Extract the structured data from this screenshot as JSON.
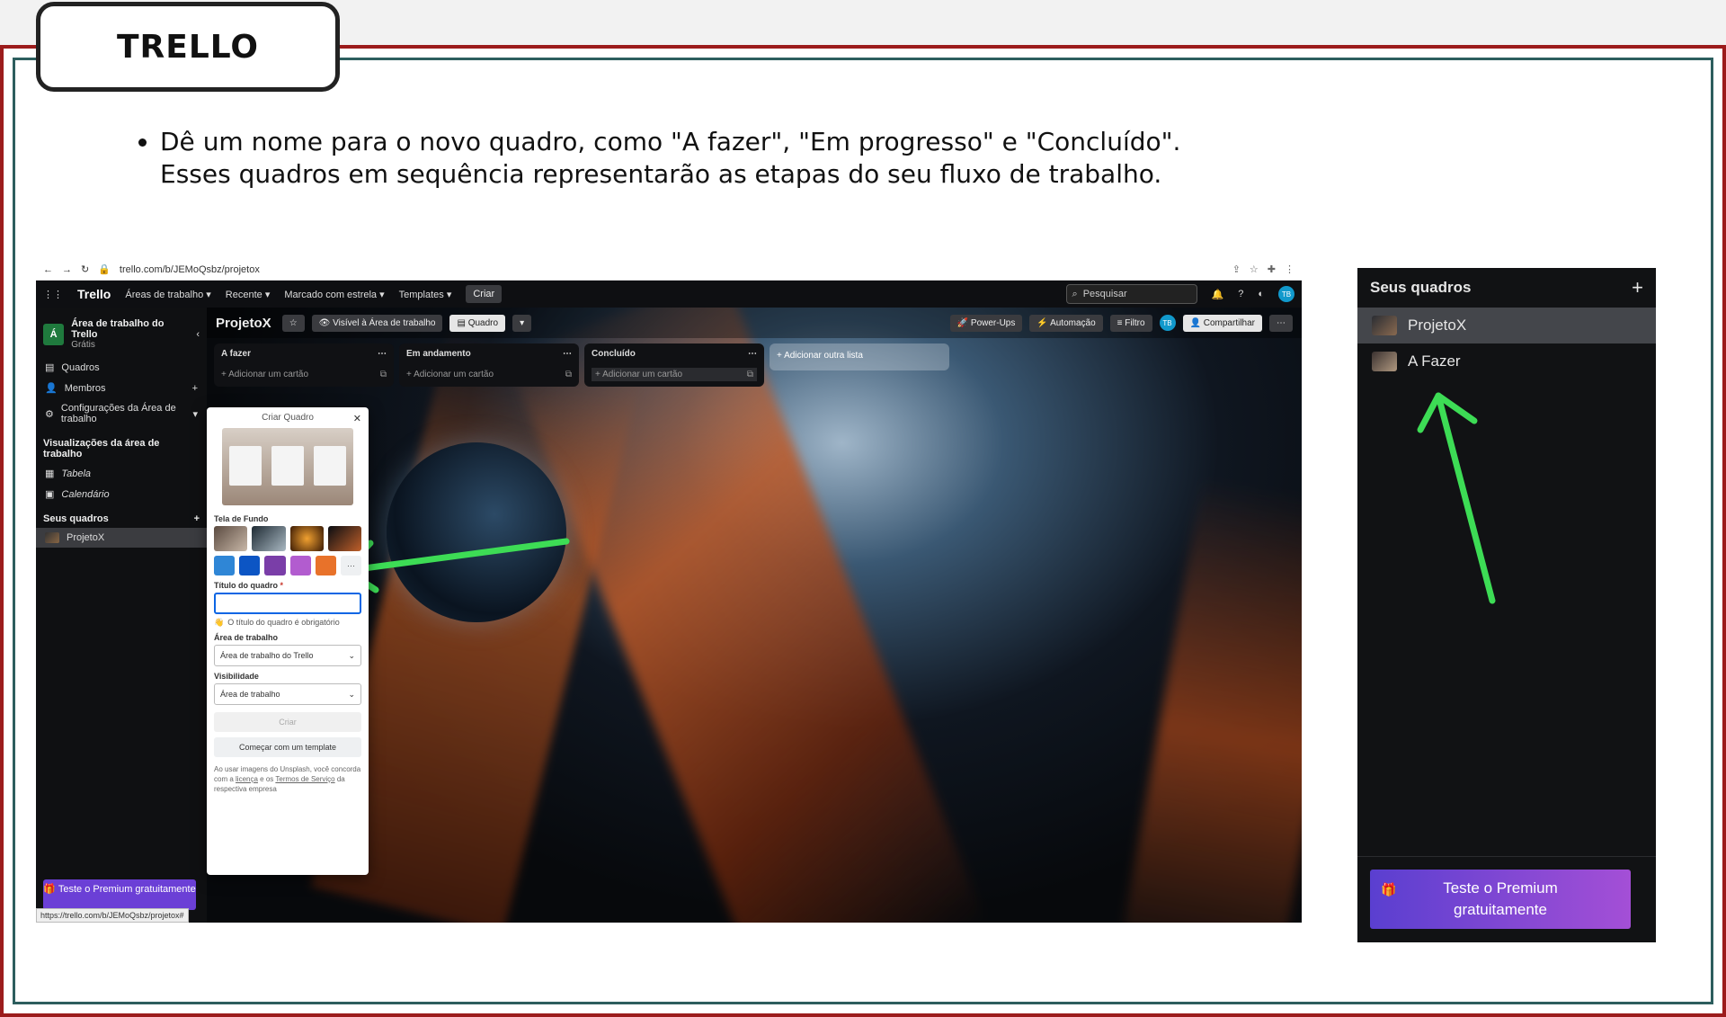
{
  "slide": {
    "title": "TRELLO",
    "bullet_line1": "Dê um nome para o novo quadro, como \"A fazer\", \"Em progresso\" e \"Concluído\".",
    "bullet_line2": "Esses quadros em sequência representarão as etapas do seu fluxo de trabalho."
  },
  "browser": {
    "url": "trello.com/b/JEMoQsbz/projetox",
    "status_url": "https://trello.com/b/JEMoQsbz/projetox#"
  },
  "topnav": {
    "logo": "Trello",
    "workspaces": "Áreas de trabalho",
    "recent": "Recente",
    "starred": "Marcado com estrela",
    "templates": "Templates",
    "create": "Criar",
    "search_placeholder": "Pesquisar",
    "avatar_initials": "TB"
  },
  "sidebar": {
    "badge": "Á",
    "workspace_name": "Área de trabalho do Trello",
    "plan": "Grátis",
    "items": [
      {
        "label": "Quadros"
      },
      {
        "label": "Membros"
      },
      {
        "label": "Configurações da Área de trabalho"
      }
    ],
    "views_header": "Visualizações da área de trabalho",
    "views": [
      {
        "label": "Tabela"
      },
      {
        "label": "Calendário"
      }
    ],
    "boards_header": "Seus quadros",
    "boards": [
      {
        "label": "ProjetoX"
      }
    ],
    "premium": "Teste o Premium gratuitamente"
  },
  "board": {
    "name": "ProjetoX",
    "visibility": "Visível à Área de trabalho",
    "view": "Quadro",
    "powerups": "Power-Ups",
    "automation": "Automação",
    "filter": "Filtro",
    "share": "Compartilhar",
    "lists": [
      {
        "title": "A fazer",
        "add": "Adicionar um cartão"
      },
      {
        "title": "Em andamento",
        "add": "Adicionar um cartão"
      },
      {
        "title": "Concluído",
        "add": "Adicionar um cartão"
      }
    ],
    "add_list": "Adicionar outra lista"
  },
  "create_board": {
    "title": "Criar Quadro",
    "background_label": "Tela de Fundo",
    "title_label": "Título do quadro",
    "required_mark": "*",
    "title_value": "",
    "warning": "O título do quadro é obrigatório",
    "workspace_label": "Área de trabalho",
    "workspace_value": "Área de trabalho do Trello",
    "visibility_label": "Visibilidade",
    "visibility_value": "Área de trabalho",
    "create_button": "Criar",
    "template_button": "Começar com um template",
    "legal_prefix": "Ao usar imagens do Unsplash, você concorda com a",
    "legal_license": "licença",
    "legal_and": "e os",
    "legal_terms": "Termos de Serviço",
    "legal_suffix": "da respectiva empresa",
    "color_swatches": [
      "#2f86d6",
      "#0c55c4",
      "#7a3ea8",
      "#b25ccf",
      "#e8722a"
    ]
  },
  "panel": {
    "header": "Seus quadros",
    "items": [
      {
        "label": "ProjetoX"
      },
      {
        "label": "A Fazer"
      }
    ],
    "premium": "Teste o Premium gratuitamente"
  },
  "colors": {
    "arrow": "#3ddc55",
    "slide_border_outer": "#9c1c1c",
    "slide_border_inner": "#2d5e5e",
    "premium": "#6b3fd6"
  }
}
